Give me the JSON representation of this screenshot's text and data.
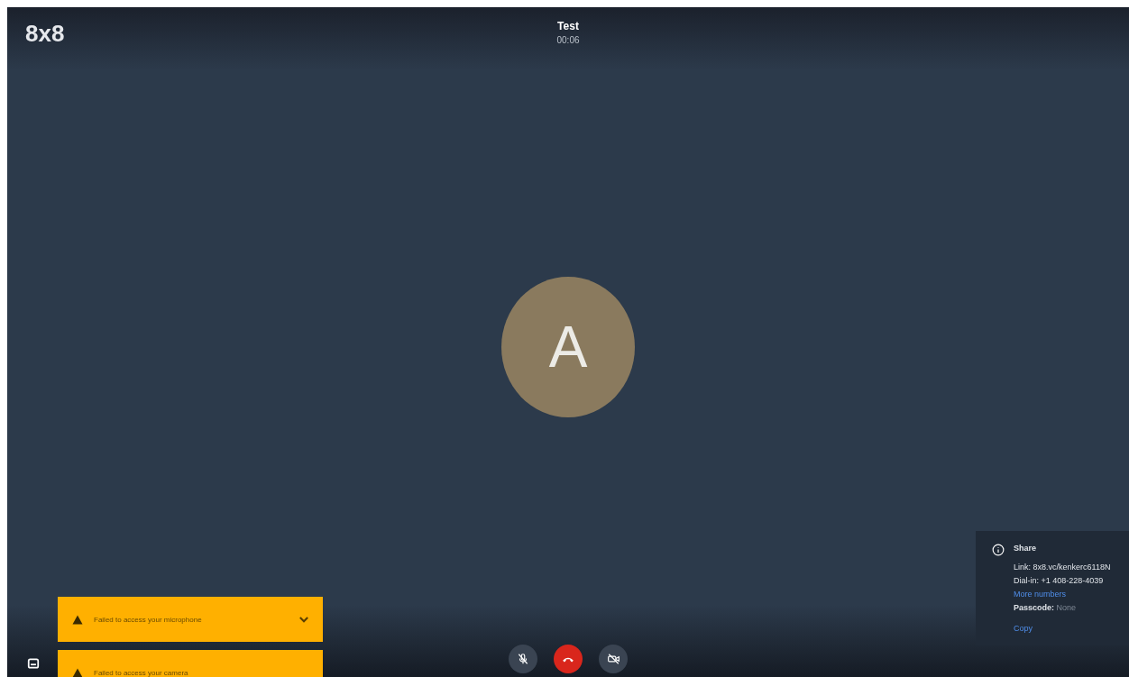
{
  "logo": "8x8",
  "meeting": {
    "title": "Test",
    "timer": "00:06"
  },
  "participant": {
    "initial": "A"
  },
  "share_panel": {
    "title": "Share",
    "link_label": "Link:",
    "link": "8x8.vc/kenkerc6118N",
    "dialin_label": "Dial-in:",
    "dialin": "+1 408-228-4039",
    "more_numbers": "More numbers",
    "passcode_label": "Passcode:",
    "passcode": "None",
    "copy": "Copy"
  },
  "notifications": [
    {
      "text": "Failed to access your microphone",
      "expandable": true
    },
    {
      "text": "Failed to access your camera",
      "expandable": false
    }
  ],
  "controls": [
    {
      "kind": "mic_off"
    },
    {
      "kind": "hangup"
    },
    {
      "kind": "camera_off"
    }
  ]
}
